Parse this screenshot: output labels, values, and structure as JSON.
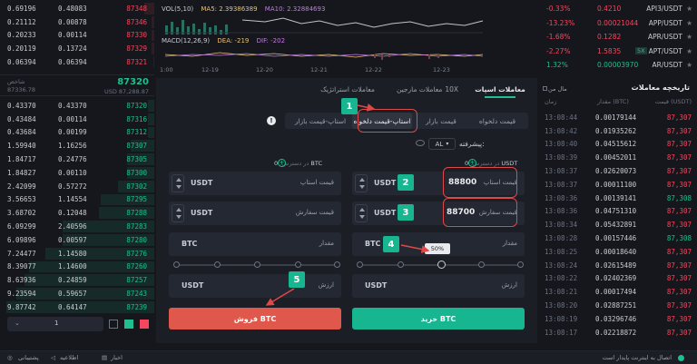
{
  "chart_header": {
    "vol": "VOL(5,10)",
    "ma5_label": "MA5:",
    "ma5": "2.39386389",
    "ma10_label": "MA10:",
    "ma10": "2.32884693",
    "macd": "MACD(12,26,9)",
    "dea_label": "DEA:",
    "dea": "-219",
    "dif_label": "DIF:",
    "dif": "-202",
    "time_axis": [
      "1:00",
      "12-19",
      "12-20",
      "12-21",
      "12-22",
      "12-23"
    ]
  },
  "orderbook_top": [
    {
      "total": "0.69196",
      "amount": "0.48083",
      "price": "87348"
    },
    {
      "total": "0.21112",
      "amount": "0.00878",
      "price": "87346"
    },
    {
      "total": "0.20233",
      "amount": "0.00114",
      "price": "87330"
    },
    {
      "total": "0.20119",
      "amount": "0.13724",
      "price": "87329"
    },
    {
      "total": "0.06394",
      "amount": "0.06394",
      "price": "87321"
    }
  ],
  "mid": {
    "price": "87320",
    "sub_label": "شاخص",
    "index": "87336.78",
    "usd": "USD 87,288.87"
  },
  "orderbook_bottom": [
    {
      "total": "0.43370",
      "amount": "0.43370",
      "price": "87320"
    },
    {
      "total": "0.43484",
      "amount": "0.00114",
      "price": "87316"
    },
    {
      "total": "0.43684",
      "amount": "0.00199",
      "price": "87312"
    },
    {
      "total": "1.59940",
      "amount": "1.16256",
      "price": "87307"
    },
    {
      "total": "1.84717",
      "amount": "0.24776",
      "price": "87305"
    },
    {
      "total": "1.84827",
      "amount": "0.00110",
      "price": "87300"
    },
    {
      "total": "2.42099",
      "amount": "0.57272",
      "price": "87302"
    },
    {
      "total": "3.56653",
      "amount": "1.14554",
      "price": "87295"
    },
    {
      "total": "3.68702",
      "amount": "0.12048",
      "price": "87288"
    },
    {
      "total": "6.09299",
      "amount": "2.40596",
      "price": "87283"
    },
    {
      "total": "6.09896",
      "amount": "0.00597",
      "price": "87280"
    },
    {
      "total": "7.24477",
      "amount": "1.14580",
      "price": "87276"
    },
    {
      "total": "8.39077",
      "amount": "1.14600",
      "price": "87260"
    },
    {
      "total": "8.63936",
      "amount": "0.24859",
      "price": "87257"
    },
    {
      "total": "9.23594",
      "amount": "0.59657",
      "price": "87243"
    },
    {
      "total": "9.87742",
      "amount": "0.64147",
      "price": "87239"
    }
  ],
  "ob_footer": {
    "step_value": "1"
  },
  "market_list": [
    {
      "change": "-0.33%",
      "price": "0.4210",
      "name": "API3/USDT"
    },
    {
      "change": "-13.23%",
      "price": "0.00021044",
      "name": "APP/USDT"
    },
    {
      "change": "-1.68%",
      "price": "0.1282",
      "name": "APR/USDT"
    },
    {
      "change": "-2.27%",
      "price": "1.5835",
      "lev": "5X",
      "name": "APT/USDT"
    },
    {
      "change": "1.32%",
      "price": "0.00003970",
      "name": "AR/USDT"
    }
  ],
  "trade_tabs": {
    "spot": "معاملات اسپات",
    "margin": "معاملات مارجین",
    "margin_lev": "10X",
    "strategy": "معاملات استراتژیک"
  },
  "order_types": {
    "limit": "قیمت دلخواه",
    "market": "قیمت بازار",
    "stop_limit": "استاپ-قیمت دلخواه",
    "stop_market": "استاپ-قیمت بازار"
  },
  "advanced_label": "پیشرفته:",
  "advanced_value": "AL",
  "buy": {
    "available_label": "در دسترس:",
    "available": "0 USDT",
    "stop_label": "قیمت استاپ",
    "stop_value": "88800",
    "stop_unit": "USDT",
    "limit_label": "قیمت سفارش",
    "limit_value": "88700",
    "limit_unit": "USDT",
    "amount_label": "مقدار",
    "amount_unit": "BTC",
    "total_label": "ارزش",
    "total_unit": "USDT",
    "slider_tooltip": "50%",
    "button": "خرید BTC"
  },
  "sell": {
    "available_label": "در دسترس:",
    "available": "0 BTC",
    "stop_label": "قیمت استاپ",
    "stop_unit": "USDT",
    "limit_label": "قیمت سفارش",
    "limit_unit": "USDT",
    "amount_label": "مقدار",
    "amount_unit": "BTC",
    "total_label": "ارزش",
    "total_unit": "USDT",
    "button": "فروش BTC"
  },
  "history": {
    "title": "تاریخچه معاملات",
    "my_label": "مال من",
    "col_time": "زمان",
    "col_amount": "مقدار (BTC)",
    "col_price": "قیمت (USDT)",
    "rows": [
      {
        "time": "13:08:44",
        "amount": "0.00179144",
        "price": "87,307",
        "side": "sell"
      },
      {
        "time": "13:08:42",
        "amount": "0.01935262",
        "price": "87,307",
        "side": "sell"
      },
      {
        "time": "13:08:40",
        "amount": "0.04515612",
        "price": "87,307",
        "side": "sell"
      },
      {
        "time": "13:08:39",
        "amount": "0.00452011",
        "price": "87,307",
        "side": "sell"
      },
      {
        "time": "13:08:37",
        "amount": "0.02620073",
        "price": "87,307",
        "side": "sell"
      },
      {
        "time": "13:08:37",
        "amount": "0.00011100",
        "price": "87,307",
        "side": "sell"
      },
      {
        "time": "13:08:36",
        "amount": "0.00139141",
        "price": "87,308",
        "side": "buy"
      },
      {
        "time": "13:08:36",
        "amount": "0.04751310",
        "price": "87,307",
        "side": "sell"
      },
      {
        "time": "13:08:34",
        "amount": "0.05432891",
        "price": "87,307",
        "side": "sell"
      },
      {
        "time": "13:08:28",
        "amount": "0.00157446",
        "price": "87,308",
        "side": "buy"
      },
      {
        "time": "13:08:25",
        "amount": "0.00018640",
        "price": "87,307",
        "side": "sell"
      },
      {
        "time": "13:08:24",
        "amount": "0.02615489",
        "price": "87,307",
        "side": "sell"
      },
      {
        "time": "13:08:22",
        "amount": "0.02402369",
        "price": "87,307",
        "side": "sell"
      },
      {
        "time": "13:08:21",
        "amount": "0.00017494",
        "price": "87,307",
        "side": "sell"
      },
      {
        "time": "13:08:20",
        "amount": "0.02887251",
        "price": "87,307",
        "side": "sell"
      },
      {
        "time": "13:08:19",
        "amount": "0.03296746",
        "price": "87,307",
        "side": "sell"
      },
      {
        "time": "13:08:17",
        "amount": "0.02218872",
        "price": "87,307",
        "side": "sell"
      }
    ]
  },
  "footer": {
    "support": "پشتیبانی",
    "announcements": "اطلاعیه",
    "news": "اخبار",
    "status": "اتصال به اینترنت پایدار است"
  },
  "annotations": [
    "1",
    "2",
    "3",
    "4",
    "5"
  ],
  "colors": {
    "green": "#1fbf8f",
    "red": "#f6465d",
    "badge": "#18b591",
    "highlight": "#e04848"
  }
}
